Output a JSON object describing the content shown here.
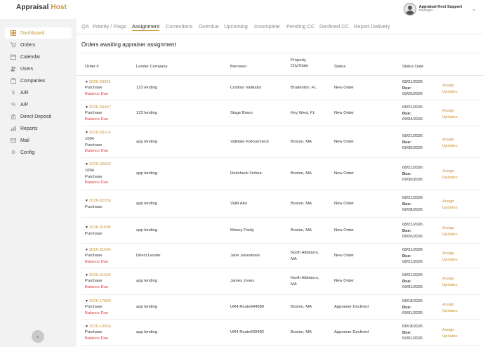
{
  "app": {
    "name_main": "Appraisal",
    "name_accent": "Host"
  },
  "user": {
    "name": "Appraisal Host Support",
    "role": "manager"
  },
  "sidebar": {
    "items": [
      {
        "label": "Dashboard",
        "icon": "dashboard-icon",
        "active": true
      },
      {
        "label": "Orders",
        "icon": "cart-icon"
      },
      {
        "label": "Calendar",
        "icon": "calendar-icon"
      },
      {
        "label": "Users",
        "icon": "users-icon"
      },
      {
        "label": "Companies",
        "icon": "companies-icon"
      },
      {
        "label": "A/R",
        "icon": "dollar-icon"
      },
      {
        "label": "A/P",
        "icon": "percent-icon"
      },
      {
        "label": "Direct Deposit",
        "icon": "bank-icon"
      },
      {
        "label": "Reports",
        "icon": "chart-icon"
      },
      {
        "label": "Mail",
        "icon": "mail-icon"
      },
      {
        "label": "Config",
        "icon": "gear-icon"
      }
    ]
  },
  "tabs": [
    {
      "label": "QA"
    },
    {
      "label": "Priority / Flags"
    },
    {
      "label": "Assignment",
      "active": true
    },
    {
      "label": "Corrections"
    },
    {
      "label": "Overdue"
    },
    {
      "label": "Upcoming"
    },
    {
      "label": "Incomplete"
    },
    {
      "label": "Pending CC"
    },
    {
      "label": "Declined CC"
    },
    {
      "label": "Report Delivery"
    }
  ],
  "section_title": "Orders awaiting appraiser assignment",
  "table": {
    "headers": {
      "order": "Order #",
      "lender": "Lender Company",
      "borrower": "Borrower",
      "property_line1": "Property",
      "property_line2": "City/State",
      "status": "Status",
      "dates": "Status Date"
    },
    "due_label": "Due:",
    "assign_label": "Assign",
    "updates_label": "Updates",
    "rows": [
      {
        "order": "2026-33921",
        "type": "Purchase",
        "type2": "",
        "balance": "Balance Due",
        "lender": "123 lending",
        "borrower": "Coldrun Validator",
        "city": "Bradenton, FL",
        "city2": "",
        "status": "New Order",
        "status_date": "08/21/2026",
        "due_date": "09/25/2026"
      },
      {
        "order": "2026-33437",
        "type": "Purchase",
        "type2": "",
        "balance": "Balance Due",
        "lender": "123 lending",
        "borrower": "Stage Bravo",
        "city": "Key West, FL",
        "city2": "",
        "status": "New Order",
        "status_date": "08/21/2026",
        "due_date": "09/04/2026"
      },
      {
        "order": "2026-33114",
        "type": "1004",
        "type2": "Purchase",
        "balance": "Balance Due",
        "lender": "app lending",
        "borrower": "Validate Fixfourcheck",
        "city": "Boston, MA",
        "city2": "",
        "status": "New Order",
        "status_date": "08/21/2026",
        "due_date": "09/30/2026"
      },
      {
        "order": "2026-32662",
        "type": "1004",
        "type2": "Purchase",
        "balance": "Balance Due",
        "lender": "app lending",
        "borrower": "Redcheck Fixfour",
        "city": "Boston, MA",
        "city2": "",
        "status": "New Order",
        "status_date": "08/21/2026",
        "due_date": "09/30/2026"
      },
      {
        "order": "2026-32336",
        "type": "Purchase",
        "type2": "",
        "balance": "",
        "lender": "app lending",
        "borrower": "Valid Ator",
        "city": "Boston, MA",
        "city2": "",
        "status": "New Order",
        "status_date": "08/21/2026",
        "due_date": "08/28/2026"
      },
      {
        "order": "2026-31695",
        "type": "Purchase",
        "type2": "",
        "balance": "",
        "lender": "app lending",
        "borrower": "Money Parity",
        "city": "Boston, MA",
        "city2": "",
        "status": "New Order",
        "status_date": "08/21/2026",
        "due_date": "08/26/2026"
      },
      {
        "order": "2026-31694",
        "type": "Purchase",
        "type2": "",
        "balance": "Balance Due",
        "lender": "Direct Lender",
        "borrower": "Jane Janestown",
        "city": "North Attleboro,",
        "city2": "MA",
        "status": "New Order",
        "status_date": "08/21/2026",
        "due_date": "08/21/2026"
      },
      {
        "order": "2026-31693",
        "type": "Purchase",
        "type2": "",
        "balance": "Balance Due",
        "lender": "app lending",
        "borrower": "James Jones",
        "city": "North Attleboro,",
        "city2": "MA",
        "status": "New Order",
        "status_date": "08/21/2026",
        "due_date": "09/01/2026"
      },
      {
        "order": "2026-17889",
        "type": "Purchase",
        "type2": "",
        "balance": "Balance Due",
        "lender": "app lending",
        "borrower": "UR4 Route844980",
        "city": "Boston, MA",
        "city2": "",
        "status": "Appraiser Declined",
        "status_date": "08/18/2026",
        "due_date": "09/01/2026"
      },
      {
        "order": "2026-13554",
        "type": "Purchase",
        "type2": "",
        "balance": "Balance Due",
        "lender": "app lending",
        "borrower": "UR4 Route600482",
        "city": "Boston, MA",
        "city2": "",
        "status": "Appraiser Declined",
        "status_date": "08/18/2026",
        "due_date": "09/01/2026"
      }
    ]
  },
  "colors": {
    "accent": "#c8963a",
    "balance_due": "#e53935",
    "sidebar_bg": "#f2f2f2"
  }
}
